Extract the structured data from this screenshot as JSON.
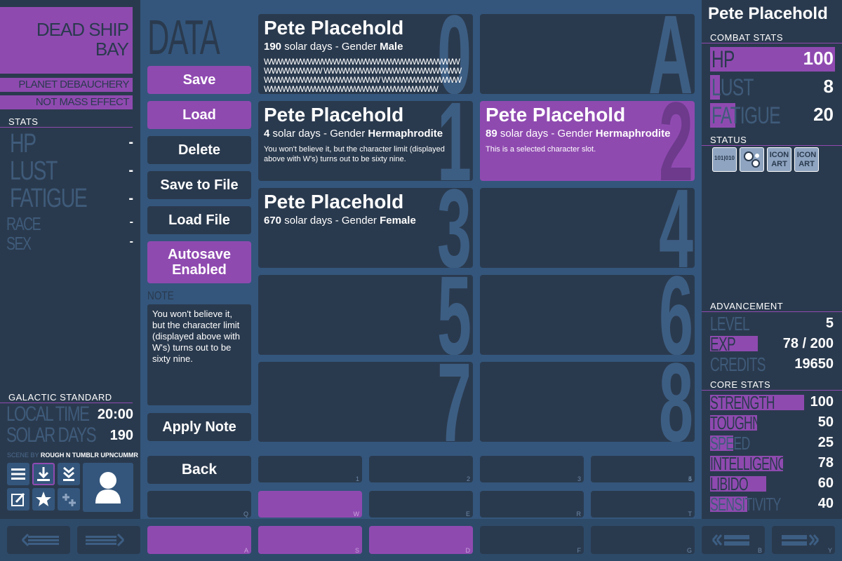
{
  "left": {
    "location": "DEAD SHIP BAY",
    "planet": "PLANET DEBAUCHERY",
    "nebula": "NOT MASS EFFECT NEBULA",
    "stats_header": "STATS",
    "stats": [
      {
        "label": "HP",
        "value": "-"
      },
      {
        "label": "LUST",
        "value": "-"
      },
      {
        "label": "FATIGUE",
        "value": "-"
      },
      {
        "label": "RACE",
        "value": "-"
      },
      {
        "label": "SEX",
        "value": "-"
      }
    ],
    "galactic_header": "GALACTIC STANDARD",
    "local_time_label": "LOCAL TIME",
    "local_time_value": "20:00",
    "solar_days_label": "SOLAR DAYS",
    "solar_days_value": "190",
    "scene_label": "SCENE BY",
    "scene_author": "ROUGH N TUMBLR UPNCUMMR"
  },
  "menu": {
    "title": "DATA",
    "save": "Save",
    "load": "Load",
    "delete": "Delete",
    "save_to_file": "Save to File",
    "load_file": "Load File",
    "autosave": "Autosave Enabled",
    "note_label": "NOTE",
    "note_text": "You won't believe it, but the character limit (displayed above with W's) turns out to be sixty nine.",
    "apply_note": "Apply Note",
    "back": "Back"
  },
  "slots": [
    {
      "num": "0",
      "name": "Pete Placehold",
      "days": "190",
      "days_suffix": " solar days - Gender ",
      "gender": "Male",
      "desc": "WWWWWWWWWWWWWWWWWWWWWWWWWWWWWWWWWWW WWWWWWWWWWWWWWWWWWWWWWWWWWWWWWWWWWW WWWWWWWWWWWWWWWWWWWWWWWWWWWWWWWWWWW"
    },
    {
      "num": "A",
      "name": "",
      "days": "",
      "days_suffix": "",
      "gender": "",
      "desc": ""
    },
    {
      "num": "1",
      "name": "Pete Placehold",
      "days": "4",
      "days_suffix": " solar days - Gender ",
      "gender": "Hermaphrodite",
      "desc": "You won't believe it, but the character limit (displayed above with W's) turns out to be sixty nine."
    },
    {
      "num": "2",
      "name": "Pete Placehold",
      "days": "89",
      "days_suffix": " solar days - Gender ",
      "gender": "Hermaphrodite",
      "desc": "This is a selected character slot."
    },
    {
      "num": "3",
      "name": "Pete Placehold",
      "days": "670",
      "days_suffix": " solar days - Gender ",
      "gender": "Female",
      "desc": ""
    },
    {
      "num": "4",
      "name": "",
      "days": "",
      "days_suffix": "",
      "gender": "",
      "desc": ""
    },
    {
      "num": "5",
      "name": "",
      "days": "",
      "days_suffix": "",
      "gender": "",
      "desc": ""
    },
    {
      "num": "6",
      "name": "",
      "days": "",
      "days_suffix": "",
      "gender": "",
      "desc": ""
    },
    {
      "num": "7",
      "name": "",
      "days": "",
      "days_suffix": "",
      "gender": "",
      "desc": ""
    },
    {
      "num": "8",
      "name": "",
      "days": "",
      "days_suffix": "",
      "gender": "",
      "desc": ""
    }
  ],
  "hotkeys": {
    "row1": [
      "1",
      "2",
      "3",
      "4",
      "5"
    ],
    "row2": [
      "Q",
      "W",
      "E",
      "R",
      "T"
    ],
    "row3": [
      "A",
      "S",
      "D",
      "F",
      "G"
    ]
  },
  "right": {
    "char_name": "Pete Placehold",
    "combat_header": "COMBAT STATS",
    "hp_label": "HP",
    "hp_value": "100",
    "lust_label": "LUST",
    "lust_value": "8",
    "fatigue_label": "FATIGUE",
    "fatigue_value": "20",
    "status_header": "STATUS",
    "status_icons": [
      "101|010",
      "bubbles",
      "ICON ART",
      "ICON ART"
    ],
    "advancement_header": "ADVANCEMENT",
    "level_label": "LEVEL",
    "level_value": "5",
    "exp_label": "EXP",
    "exp_value": "78 / 200",
    "credits_label": "CREDITS",
    "credits_value": "19650",
    "core_header": "CORE STATS",
    "core": [
      {
        "label": "STRENGTH",
        "value": "100",
        "fill": 1.0
      },
      {
        "label": "TOUGHNESS",
        "value": "50",
        "fill": 0.5
      },
      {
        "label": "SPEED",
        "value": "25",
        "fill": 0.25
      },
      {
        "label": "INTELLIGENCE",
        "value": "78",
        "fill": 0.78
      },
      {
        "label": "LIBIDO",
        "value": "60",
        "fill": 0.6
      },
      {
        "label": "SENSITIVITY",
        "value": "40",
        "fill": 0.4
      }
    ]
  },
  "bottom": {
    "key_left": "B",
    "key_right": "Y"
  }
}
